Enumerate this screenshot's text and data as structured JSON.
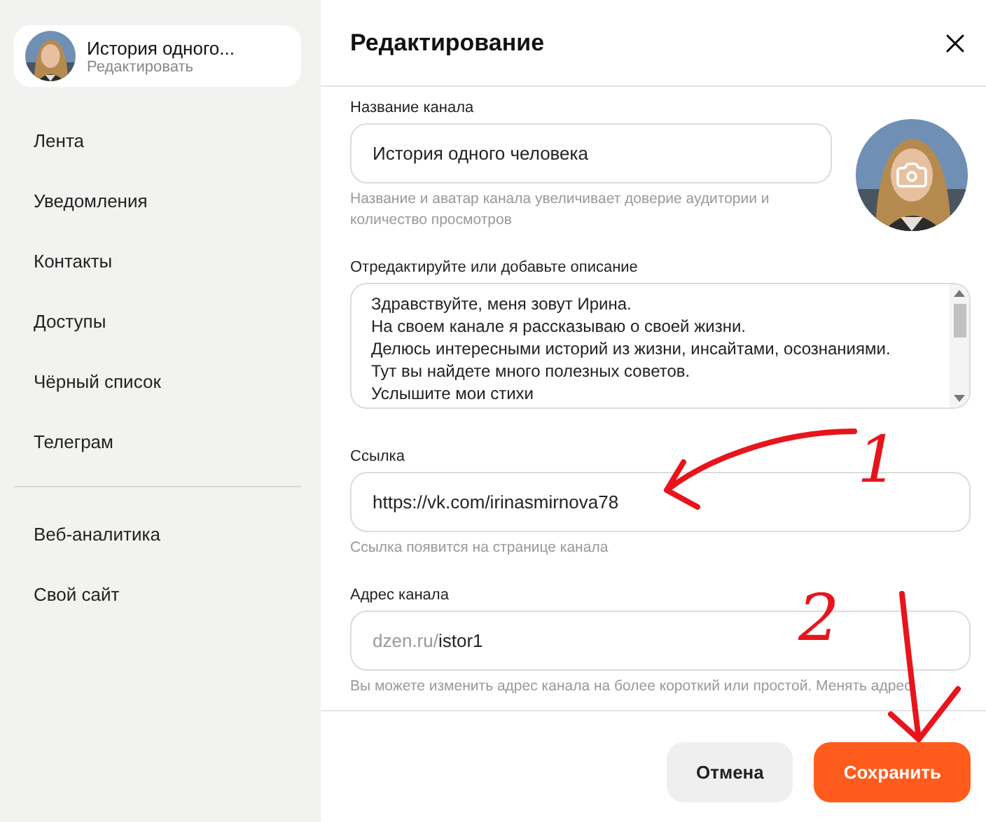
{
  "sidebar": {
    "channel": {
      "name": "История одного...",
      "action": "Редактировать"
    },
    "items": [
      {
        "label": "Лента",
        "selected": false
      },
      {
        "label": "Уведомления",
        "selected": false
      },
      {
        "label": "Контакты",
        "selected": false
      },
      {
        "label": "Доступы",
        "selected": false
      },
      {
        "label": "Чёрный список",
        "selected": false
      },
      {
        "label": "Телеграм",
        "selected": false
      }
    ],
    "extra_items": [
      {
        "label": "Веб-аналитика",
        "selected": false
      },
      {
        "label": "Свой сайт",
        "selected": false
      }
    ]
  },
  "dialog": {
    "title": "Редактирование",
    "name_field": {
      "label": "Название канала",
      "value": "История одного человека",
      "hint": "Название и аватар канала увеличивает доверие аудитории и количество просмотров"
    },
    "description": {
      "label": "Отредактируйте или добавьте описание",
      "lines": [
        "Здравствуйте, меня зовут Ирина.",
        "На своем канале я рассказываю о своей жизни.",
        "Делюсь интересными историй из жизни, инсайтами, осознаниями.",
        "Тут вы найдете много полезных советов.",
        "Услышите мои стихи"
      ]
    },
    "link_field": {
      "label": "Ссылка",
      "value": "https://vk.com/irinasmirnova78",
      "hint": "Ссылка появится на странице канала"
    },
    "address_field": {
      "label": "Адрес канала",
      "prefix": "dzen.ru/",
      "value": "istor1",
      "hint": "Вы можете изменить адрес канала на более короткий или простой. Менять адрес"
    },
    "buttons": [
      {
        "label": "Отмена",
        "kind": "secondary"
      },
      {
        "label": "Сохранить",
        "kind": "primary"
      }
    ]
  },
  "annotations": [
    {
      "label": "1",
      "color": "#e8141c"
    },
    {
      "label": "2",
      "color": "#e8141c"
    }
  ]
}
